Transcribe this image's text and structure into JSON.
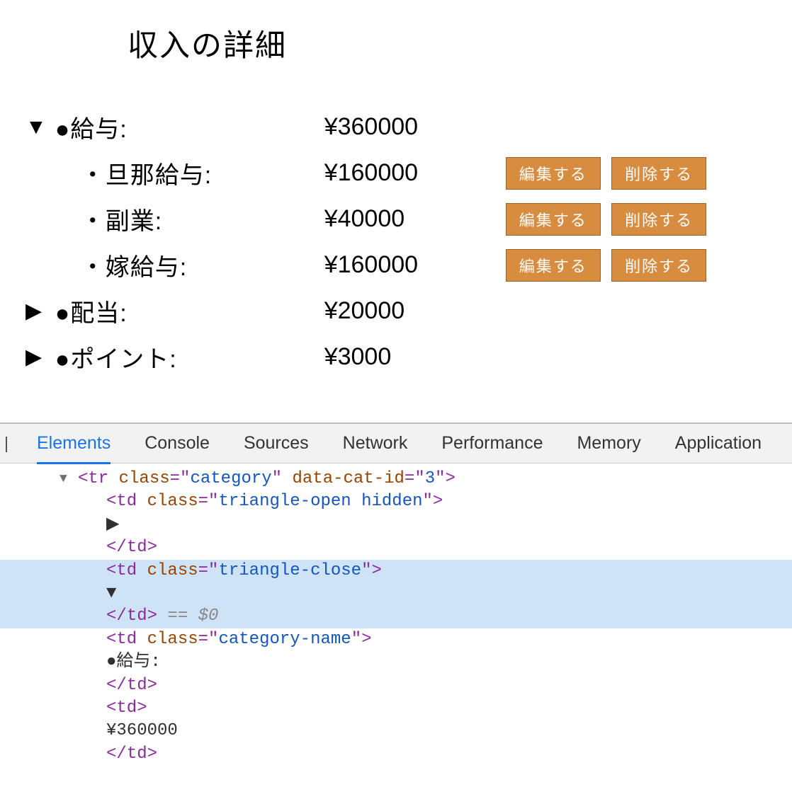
{
  "page": {
    "title": "収入の詳細"
  },
  "buttons": {
    "edit_label": "編集する",
    "delete_label": "削除する"
  },
  "symbols": {
    "triangle_down": "▼",
    "triangle_right": "▶",
    "bullet": "●",
    "small_bullet": "・"
  },
  "income": {
    "categories": [
      {
        "expanded": true,
        "name": "給与",
        "amount": "¥360000",
        "subitems": [
          {
            "name": "旦那給与",
            "amount": "¥160000"
          },
          {
            "name": "副業",
            "amount": "¥40000"
          },
          {
            "name": "嫁給与",
            "amount": "¥160000"
          }
        ]
      },
      {
        "expanded": false,
        "name": "配当",
        "amount": "¥20000",
        "subitems": []
      },
      {
        "expanded": false,
        "name": "ポイント",
        "amount": "¥3000",
        "subitems": []
      }
    ]
  },
  "cat0": {
    "label": "●給与:",
    "amount": "¥360000",
    "triangle": "▼",
    "sub0": {
      "label": "・旦那給与:",
      "amount": "¥160000"
    },
    "sub1": {
      "label": "・副業:",
      "amount": "¥40000"
    },
    "sub2": {
      "label": "・嫁給与:",
      "amount": "¥160000"
    }
  },
  "cat1": {
    "label": "●配当:",
    "amount": "¥20000",
    "triangle": "▶"
  },
  "cat2": {
    "label": "●ポイント:",
    "amount": "¥3000",
    "triangle": "▶"
  },
  "devtools": {
    "tabs": {
      "elements": "Elements",
      "console": "Console",
      "sources": "Sources",
      "network": "Network",
      "performance": "Performance",
      "memory": "Memory",
      "application": "Application"
    },
    "source": {
      "tr_open": "<tr class=\"category\" data-cat-id=\"3\">",
      "td1_open": "<td class=\"triangle-open hidden\">",
      "td1_content": "▶",
      "td_close": "</td>",
      "td2_open": "<td class=\"triangle-close\">",
      "td2_content": "▼",
      "eq_var": " == $0",
      "td3_open": "<td class=\"category-name\">",
      "td3_content": "●給与:",
      "td4_open": "<td>",
      "td4_content": "¥360000",
      "gutter_triangle": "▼"
    }
  }
}
